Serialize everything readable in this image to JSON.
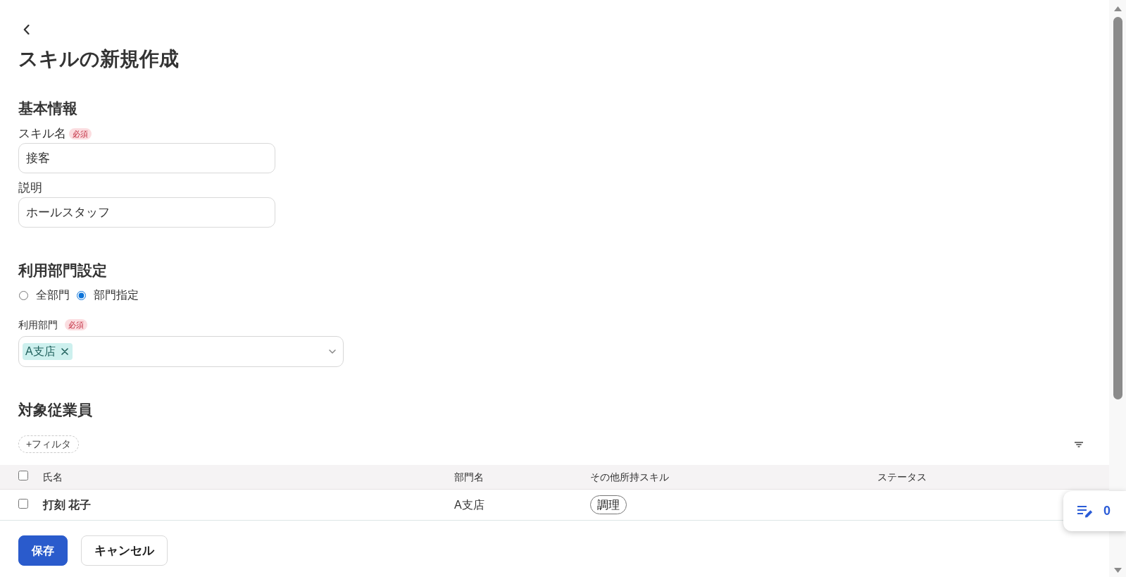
{
  "page": {
    "title": "スキルの新規作成"
  },
  "basic_info": {
    "heading": "基本情報",
    "fields": [
      {
        "label": "スキル名",
        "required_badge": "必須",
        "value": "接客"
      },
      {
        "label": "説明",
        "value": "ホールスタッフ"
      }
    ]
  },
  "department_settings": {
    "heading": "利用部門設定",
    "radios": [
      {
        "label": "全部門",
        "selected": false
      },
      {
        "label": "部門指定",
        "selected": true
      }
    ],
    "department_select": {
      "label": "利用部門",
      "required_badge": "必須",
      "tags": [
        "A支店"
      ]
    }
  },
  "employees": {
    "heading": "対象従業員",
    "filter_button": "+フィルタ",
    "table": {
      "select_all_checked": false,
      "columns": [
        "氏名",
        "部門名",
        "その他所持スキル",
        "ステータス"
      ],
      "rows": [
        {
          "checked": false,
          "name": "打刻 花子",
          "department": "A支店",
          "skills": [
            "調理"
          ]
        }
      ]
    }
  },
  "footer": {
    "buttons": [
      {
        "label": "保存",
        "kind": "primary"
      },
      {
        "label": "キャンセル",
        "kind": "secondary"
      }
    ]
  },
  "floating_button": {
    "count": "0"
  }
}
